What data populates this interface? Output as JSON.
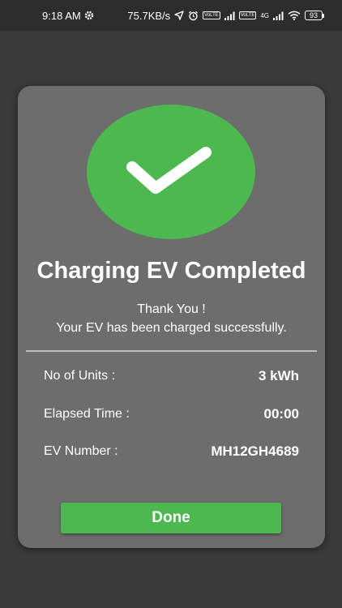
{
  "status_bar": {
    "time": "9:18 AM",
    "network_speed": "75.7KB/s",
    "volte_label_1": "VoLTE",
    "volte_label_2": "VoLTE",
    "network_type": "4G",
    "battery_level": "93",
    "icons": [
      "gear-icon",
      "location-arrow-icon",
      "alarm-icon",
      "signal-icon",
      "wifi-icon",
      "battery-icon"
    ]
  },
  "dialog": {
    "icon": "check-circle-icon",
    "title": "Charging EV Completed",
    "message_line_1": "Thank You !",
    "message_line_2": "Your EV has been charged successfully.",
    "details": {
      "units_label": "No of Units :",
      "units_value": "3 kWh",
      "elapsed_label": "Elapsed Time :",
      "elapsed_value": "00:00",
      "ev_label": "EV Number :",
      "ev_value": "MH12GH4689"
    },
    "done_label": "Done"
  },
  "colors": {
    "background": "#3a3a3a",
    "dialog": "#6d6d6d",
    "accent_green": "#4db850",
    "text": "#ffffff"
  }
}
